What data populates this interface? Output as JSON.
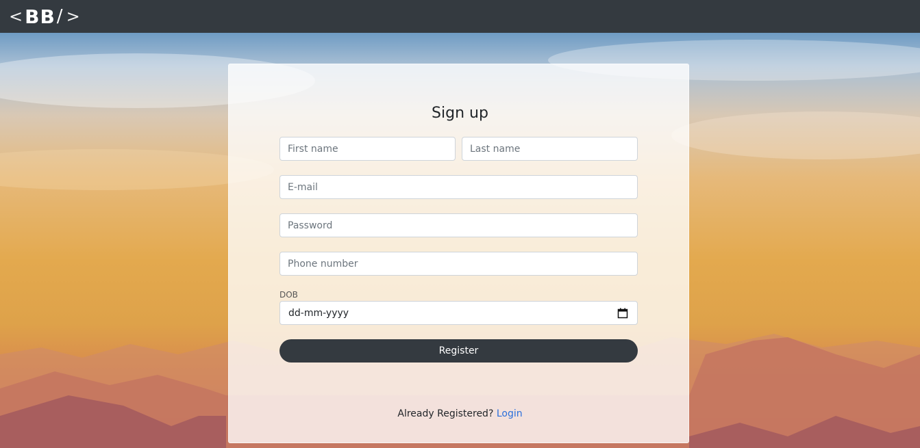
{
  "brand": {
    "open": "<",
    "name": "BB",
    "slash": "/",
    "close": ">"
  },
  "form": {
    "title": "Sign up",
    "first_name_placeholder": "First name",
    "last_name_placeholder": "Last name",
    "email_placeholder": "E-mail",
    "password_placeholder": "Password",
    "phone_placeholder": "Phone number",
    "dob_label": "DOB",
    "dob_value": "dd-mm-yyyy",
    "register_label": "Register"
  },
  "footer": {
    "prompt": "Already Registered?",
    "login_link": "Login"
  },
  "colors": {
    "navbar": "#343a40",
    "button": "#343a40",
    "link": "#2a6fdb"
  }
}
